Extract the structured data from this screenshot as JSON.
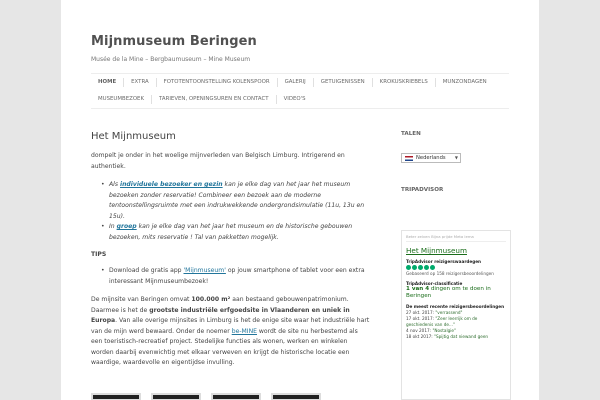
{
  "site": {
    "title": "Mijnmuseum Beringen",
    "description": "Musée de la Mine – Bergbaumuseum – Mine Museum"
  },
  "nav": {
    "row1": [
      "HOME",
      "EXTRA",
      "FOTOTENTOONSTELLING KOLENSPOOR",
      "GALERIJ",
      "GETUIGENISSEN",
      "KROKUSKRIEBELS",
      "MUNZONDAGEN"
    ],
    "row2": [
      "MUSEUMBEZOEK",
      "TARIEVEN, OPENINGSUREN EN CONTACT",
      "VIDEO'S"
    ]
  },
  "content": {
    "title": "Het Mijnmuseum",
    "intro": "dompelt je onder in het woelige mijnverleden van Belgisch Limburg. Intrigerend en authentiek.",
    "item1_prefix": "Als ",
    "item1_link": "individuele bezoeker en gezin",
    "item1_text": " kan je elke dag van het jaar het museum bezoeken zonder reservatie! Combineer een bezoek aan de moderne tentoonstellingsruimte met een indrukwekkende ondergrondsimulatie (11u, 13u en 15u).",
    "item2_prefix": "In ",
    "item2_link": "groep",
    "item2_text": " kan je elke dag van het jaar het museum en de historische gebouwen bezoeken, mits reservatie ! Tal van pakketten mogelijk.",
    "tips_label": "TIPS",
    "tip1_prefix": "Download de gratis app ",
    "tip1_link": "'Mijnmuseum'",
    "tip1_text": " op jouw smartphone of tablet voor een extra interessant Mijnmuseumbezoek!",
    "p2_a": "De mijnsite van Beringen omvat ",
    "p2_b": "100.000 m²",
    "p2_c": " aan bestaand gebouwenpatrimonium. Daarmee is het de ",
    "p2_d": "grootste industriële erfgoedsite in Vlaanderen en uniek in Europa",
    "p2_e": ". Van alle overige mijnsites in Limburg is het de enige site waar het industriële hart van de mijn werd bewaard. Onder de noemer ",
    "p2_link": "be-MINE",
    "p2_f": " wordt de site nu herbestemd als een toeristisch-recreatief project. Stedelijke functies als wonen, werken en winkelen worden daarbij evenwichtig met elkaar verweven en krijgt de historische locatie een waardige, waardevolle en eigentijdse invulling."
  },
  "sidebar": {
    "languages_title": "TALEN",
    "language_selected": "Nederlands",
    "tripadvisor_title": "TRIPADVISOR",
    "ta_lang_bar": "Beter zelven  Bijna  prijde Meta lema",
    "ta_name": "Het Mijnmuseum",
    "ta_reviews_h": "TripAdvisor reizigerswaardegen",
    "ta_reviews_t": "Gebaseerd op   158 reizigersbeoordelingen",
    "ta_rank_h": "TripAdvisor-classificatie",
    "ta_rank_num": "1 van 4",
    "ta_rank_text": " dingen om te doen in Beringen",
    "ta_recent_h": "De meest recente reizigersbeoordelingen",
    "reviews": [
      {
        "date": "27 okt. 2017:",
        "text": "\"verrassend\""
      },
      {
        "date": "17 okt. 2017:",
        "text": "\"Zeer leerrijk om de geschiedenis van de...\""
      },
      {
        "date": "4 nov 2017:",
        "text": "\"Nostalgie\""
      },
      {
        "date": "18 okt 2017:",
        "text": "\"Spijtig dat niewand geen"
      }
    ]
  },
  "colors": {
    "link": "#21759b",
    "tripadvisor_green": "#00aa6c"
  }
}
